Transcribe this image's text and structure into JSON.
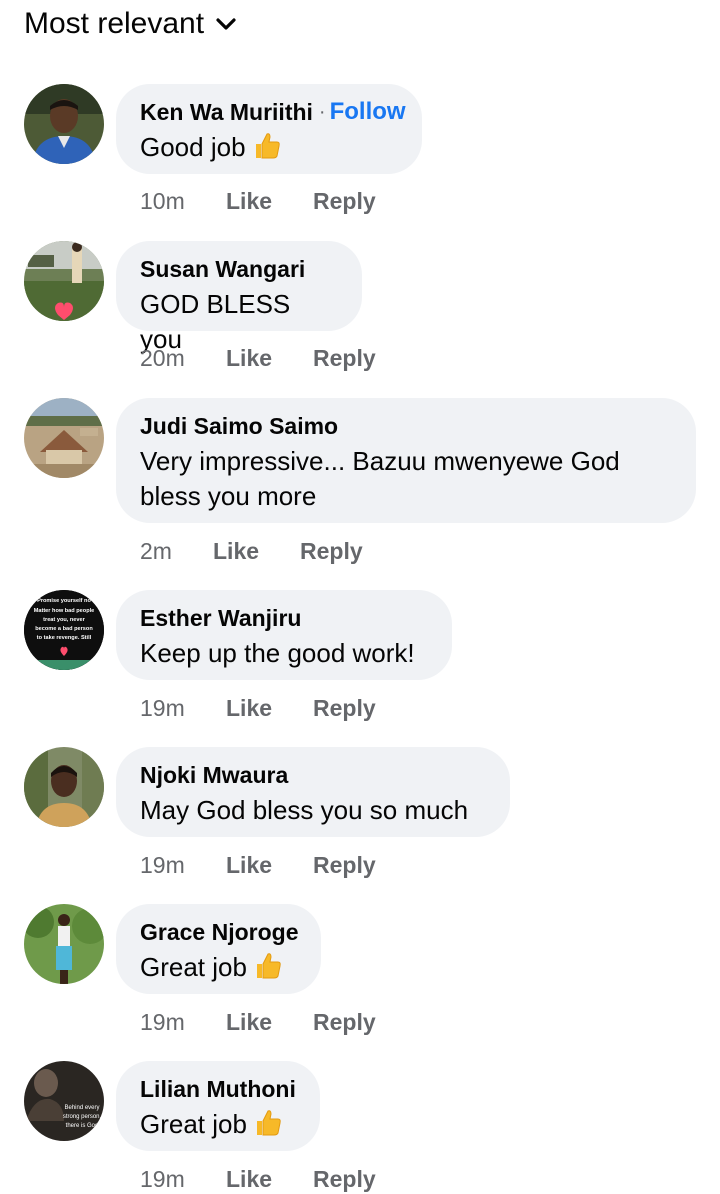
{
  "sort": {
    "label": "Most relevant"
  },
  "actions": {
    "like": "Like",
    "reply": "Reply"
  },
  "comments": [
    {
      "author": "Ken Wa Muriithi",
      "follow": "Follow",
      "text": "Good job",
      "emoji": "thumbs-up-icon",
      "time": "10m",
      "avatar": "avatar-photo-man-blue-shirt"
    },
    {
      "author": "Susan Wangari",
      "text": "GOD BLESS you",
      "time": "20m",
      "avatar": "avatar-photo-child-garden-heart"
    },
    {
      "author": "Judi Saimo Saimo",
      "text": "Very impressive... Bazuu mwenyewe God bless you more",
      "time": "2m",
      "avatar": "avatar-photo-aerial-building"
    },
    {
      "author": "Esther Wanjiru",
      "text": "Keep up the good work!",
      "time": "19m",
      "avatar": "avatar-quote-image",
      "avatar_text": "Promise yourself no Matter how bad people treat you, never become a bad person to take revenge. Still be KIND ♥ I know"
    },
    {
      "author": "Njoki Mwaura",
      "text": "May God bless you so much",
      "time": "19m",
      "avatar": "avatar-photo-woman"
    },
    {
      "author": "Grace Njoroge",
      "text": "Great job",
      "emoji": "thumbs-up-icon",
      "time": "19m",
      "avatar": "avatar-photo-woman-outdoors"
    },
    {
      "author": "Lilian Muthoni",
      "text": "Great job",
      "emoji": "thumbs-up-icon",
      "time": "19m",
      "avatar": "avatar-quote-dark",
      "avatar_text": "Behind every strong person, there is God"
    }
  ],
  "colors": {
    "bubble": "#f0f2f5",
    "follow": "#1877f2",
    "meta": "#65676b",
    "thumb": "#f7b928"
  }
}
